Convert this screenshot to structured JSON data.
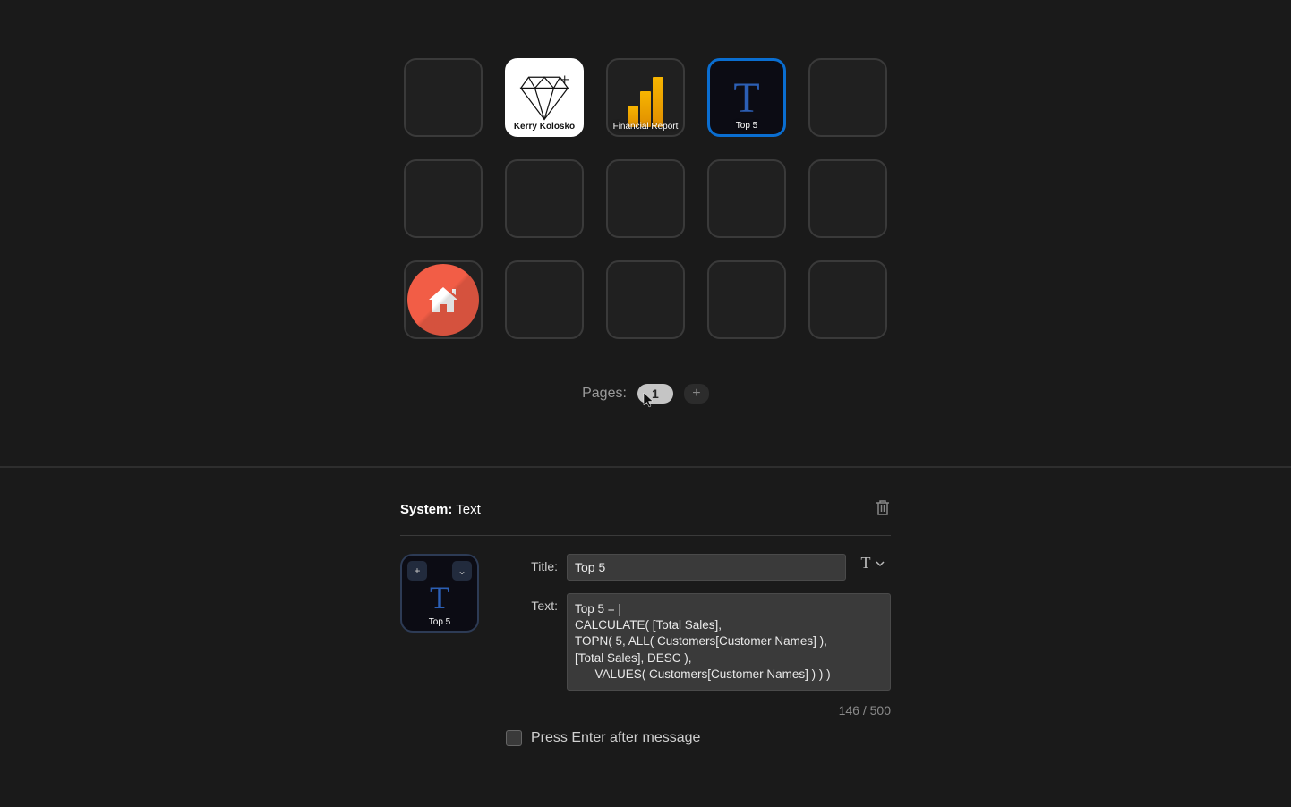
{
  "grid": {
    "tiles": [
      {
        "type": "empty"
      },
      {
        "type": "diamond",
        "label": "Kerry Kolosko"
      },
      {
        "type": "powerbi",
        "label": "Financial Report"
      },
      {
        "type": "text-tile",
        "label": "Top 5",
        "selected": true
      },
      {
        "type": "empty"
      },
      {
        "type": "empty"
      },
      {
        "type": "empty"
      },
      {
        "type": "empty"
      },
      {
        "type": "empty"
      },
      {
        "type": "empty"
      },
      {
        "type": "home"
      },
      {
        "type": "empty"
      },
      {
        "type": "empty"
      },
      {
        "type": "empty"
      },
      {
        "type": "empty"
      }
    ]
  },
  "pager": {
    "label": "Pages:",
    "current": "1",
    "add_glyph": "+"
  },
  "panel": {
    "system_label": "System:",
    "system_value": "Text",
    "title_label": "Title:",
    "title_value": "Top 5",
    "style_glyph": "T",
    "text_label": "Text:",
    "text_value": "Top 5 = |\nCALCULATE( [Total Sales],\nTOPN( 5, ALL( Customers[Customer Names] ),\n[Total Sales], DESC ),\n      VALUES( Customers[Customer Names] ) ) )",
    "char_counter": "146 / 500",
    "checkbox_label": "Press Enter after message",
    "thumb_label": "Top 5",
    "thumb_add_glyph": "+",
    "thumb_chevron_glyph": "⌄"
  }
}
